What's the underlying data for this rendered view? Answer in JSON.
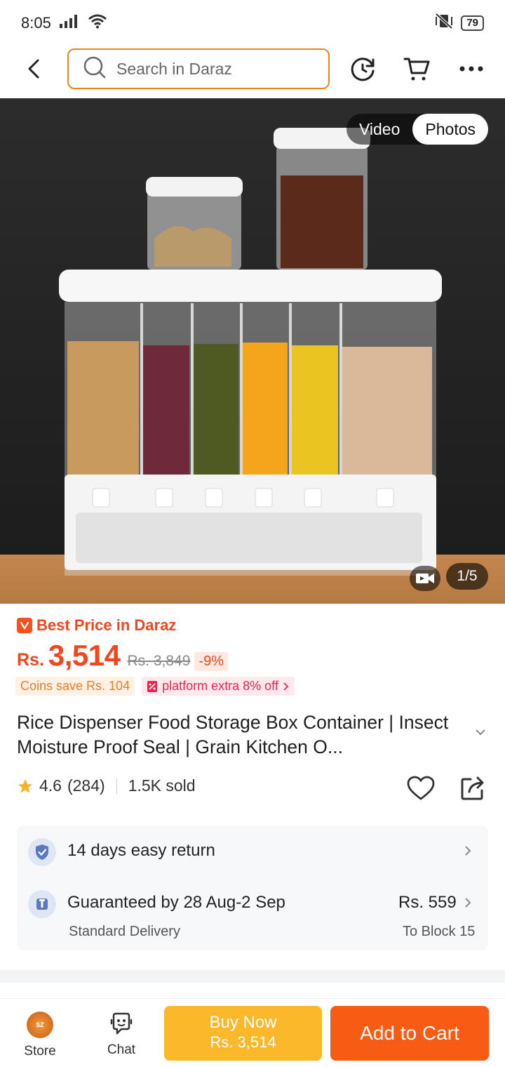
{
  "status_bar": {
    "time": "8:05",
    "battery": "79"
  },
  "header": {
    "search_placeholder": "Search in Daraz"
  },
  "gallery": {
    "video_label": "Video",
    "photos_label": "Photos",
    "counter": "1/5"
  },
  "product": {
    "best_price_label": "Best Price in Daraz",
    "currency": "Rs.",
    "price": "3,514",
    "old_price": "Rs. 3,849",
    "discount": "-9%",
    "coins_promo": "Coins save Rs. 104",
    "platform_promo": "platform extra 8% off",
    "title": "Rice Dispenser Food Storage Box Container | Insect Moisture Proof Seal | Grain Kitchen O...",
    "rating": "4.6",
    "rating_count": "(284)",
    "sold": "1.5K sold"
  },
  "services": {
    "return_label": "14 days easy return",
    "delivery_label": "Guaranteed by 28 Aug-2 Sep",
    "delivery_type": "Standard Delivery",
    "delivery_price": "Rs. 559",
    "delivery_location": "To Block 15"
  },
  "bottom_bar": {
    "store_label": "Store",
    "store_logo_text": "SZ Sanzai",
    "chat_label": "Chat",
    "buy_now_label": "Buy Now",
    "buy_now_price": "Rs. 3,514",
    "add_to_cart_label": "Add to Cart"
  },
  "colors": {
    "accent": "#f85b14",
    "price": "#f2471c",
    "buy_now": "#fab82a",
    "search_border": "#f0821e"
  }
}
